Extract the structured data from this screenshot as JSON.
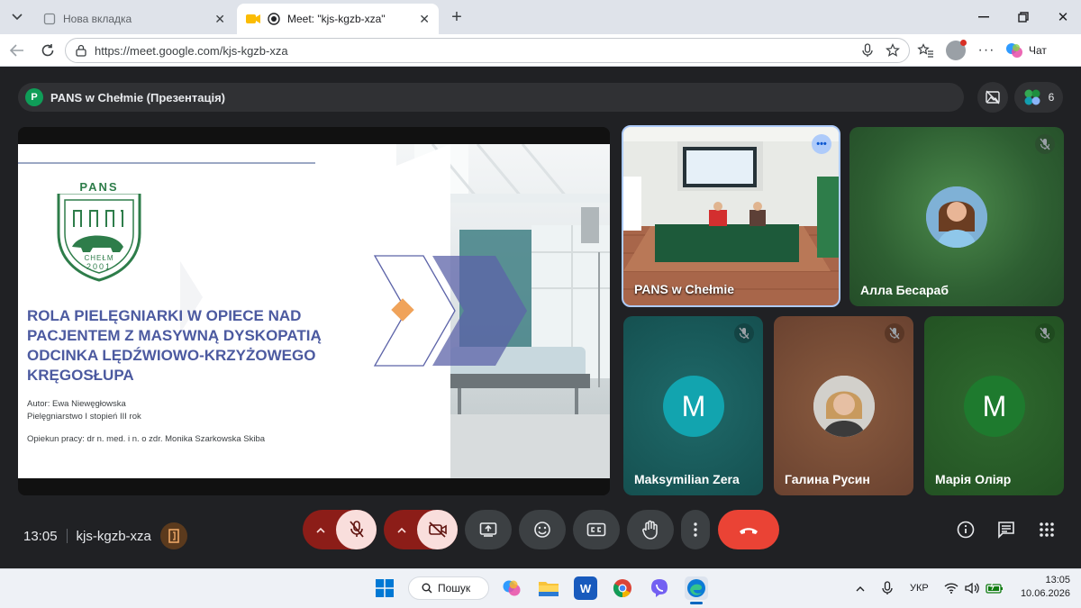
{
  "browser": {
    "tabs": [
      {
        "title": "Нова вкладка"
      },
      {
        "title": "Meet: \"kjs-kgzb-xza\""
      }
    ],
    "url": "https://meet.google.com/kjs-kgzb-xza",
    "chat_label": "Чат"
  },
  "meet": {
    "title_initial": "P",
    "title": "PANS w Chełmie (Презентація)",
    "participant_count": "6",
    "time": "13:05",
    "meeting_code": "kjs-kgzb-xza",
    "slide": {
      "logo_top": "PANS",
      "logo_city": "CHEŁM",
      "logo_year": "2001",
      "heading_lines": [
        "ROLA PIELĘGNIARKI W OPIECE NAD",
        "PACJENTEM Z MASYWNĄ DYSKOPATIĄ",
        "ODCINKA LĘDŹWIOWO-KRZYŻOWEGO",
        "KRĘGOSŁUPA"
      ],
      "author": "Autor: Ewa Niewęgłowska",
      "program": "Pielęgniarstwo I stopień III rok",
      "supervisor": "Opiekun pracy: dr n. med. i n. o zdr. Monika Szarkowska Skiba"
    },
    "participants": [
      {
        "name": "PANS w Chełmie",
        "type": "video"
      },
      {
        "name": "Алла Бесараб",
        "type": "photo",
        "muted": true
      },
      {
        "name": "Maksymilian Zera",
        "type": "letter",
        "letter": "M",
        "muted": true
      },
      {
        "name": "Галина Русин",
        "type": "photo",
        "muted": true
      },
      {
        "name": "Марія Оліяр",
        "type": "letter",
        "letter": "M",
        "muted": true
      }
    ],
    "colors": {
      "end_call": "#ea4335",
      "mic_off_bg": "#f9dedc",
      "chevron_bg": "#8c1d18"
    }
  },
  "taskbar": {
    "search_label": "Пошук",
    "language": "УКР",
    "clock_time": "13:05",
    "clock_date": "10.06.2026"
  }
}
